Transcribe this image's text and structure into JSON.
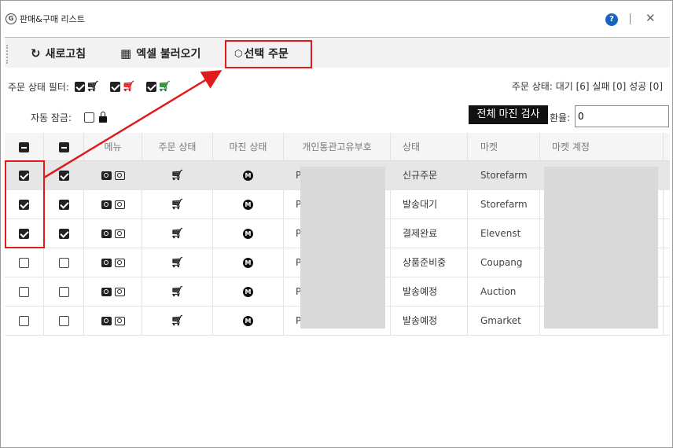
{
  "window": {
    "title": "판매&구매 리스트",
    "help": "?",
    "close": "✕"
  },
  "toolbar": {
    "refresh_label": "새로고침",
    "excel_label": "엑셀 불러오기",
    "order_label": "선택 주문"
  },
  "filter": {
    "label": "주문 상태 필터:",
    "cart_colors": [
      "#222222",
      "#e01b1b",
      "#1a8a2a"
    ]
  },
  "status_summary": "주문 상태: 대기 [6] 실패 [0] 성공 [0]",
  "auto_lock": {
    "label": "자동 잠금:"
  },
  "margin_check_label": "전체 마진 검사",
  "exchange": {
    "label": "환율:",
    "value": "0"
  },
  "columns": [
    "메뉴",
    "주문 상태",
    "마진 상태",
    "개인통관고유부호",
    "상태",
    "마켓",
    "마켓 계정"
  ],
  "rows": [
    {
      "checked": true,
      "code": "P",
      "status": "신규주문",
      "market": "Storefarm"
    },
    {
      "checked": true,
      "code": "P",
      "status": "발송대기",
      "market": "Storefarm"
    },
    {
      "checked": true,
      "code": "P",
      "status": "결제완료",
      "market": "Elevenst"
    },
    {
      "checked": false,
      "code": "P",
      "status": "상품준비중",
      "market": "Coupang"
    },
    {
      "checked": false,
      "code": "P",
      "status": "발송예정",
      "market": "Auction"
    },
    {
      "checked": false,
      "code": "P",
      "status": "발송예정",
      "market": "Gmarket"
    }
  ]
}
